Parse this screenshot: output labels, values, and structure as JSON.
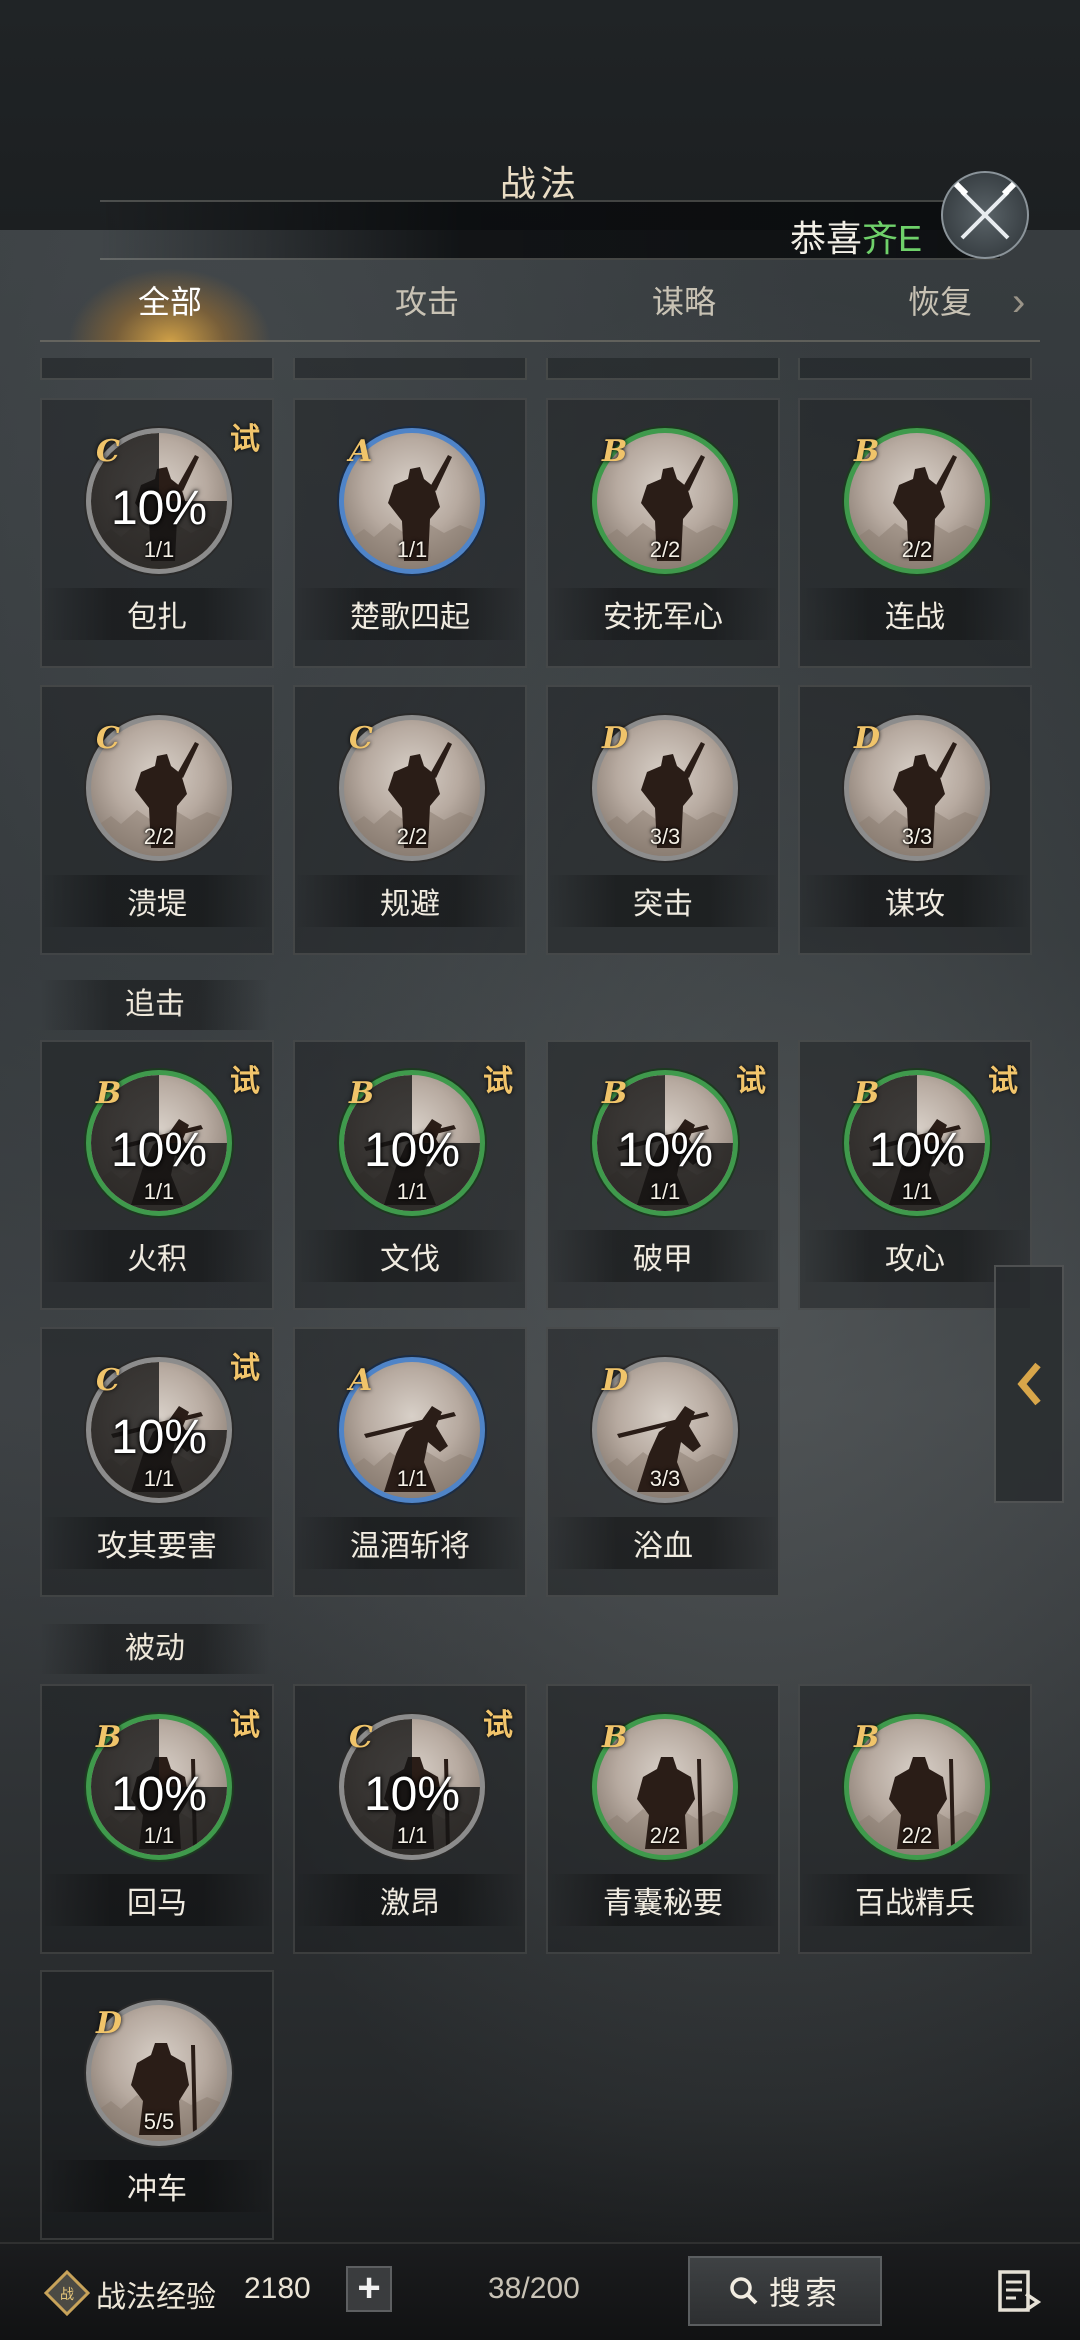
{
  "header": {
    "title": "战法",
    "ticker_prefix": "恭喜",
    "ticker_highlight": "齐E"
  },
  "tabs": [
    {
      "label": "全部",
      "active": true
    },
    {
      "label": "攻击",
      "active": false
    },
    {
      "label": "谋略",
      "active": false
    },
    {
      "label": "恢复",
      "active": false
    }
  ],
  "sections": {
    "pursuit": "追击",
    "passive": "被动"
  },
  "skills": [
    {
      "name": "包扎",
      "grade": "C",
      "count": "1/1",
      "trial": "试",
      "percent": "10%"
    },
    {
      "name": "楚歌四起",
      "grade": "A",
      "count": "1/1"
    },
    {
      "name": "安抚军心",
      "grade": "B",
      "count": "2/2"
    },
    {
      "name": "连战",
      "grade": "B",
      "count": "2/2"
    },
    {
      "name": "溃堤",
      "grade": "C",
      "count": "2/2"
    },
    {
      "name": "规避",
      "grade": "C",
      "count": "2/2"
    },
    {
      "name": "突击",
      "grade": "D",
      "count": "3/3"
    },
    {
      "name": "谋攻",
      "grade": "D",
      "count": "3/3"
    },
    {
      "name": "火积",
      "grade": "B",
      "count": "1/1",
      "trial": "试",
      "percent": "10%"
    },
    {
      "name": "文伐",
      "grade": "B",
      "count": "1/1",
      "trial": "试",
      "percent": "10%"
    },
    {
      "name": "破甲",
      "grade": "B",
      "count": "1/1",
      "trial": "试",
      "percent": "10%"
    },
    {
      "name": "攻心",
      "grade": "B",
      "count": "1/1",
      "trial": "试",
      "percent": "10%"
    },
    {
      "name": "攻其要害",
      "grade": "C",
      "count": "1/1",
      "trial": "试",
      "percent": "10%"
    },
    {
      "name": "温酒斩将",
      "grade": "A",
      "count": "1/1"
    },
    {
      "name": "浴血",
      "grade": "D",
      "count": "3/3"
    },
    {
      "name": "回马",
      "grade": "B",
      "count": "1/1",
      "trial": "试",
      "percent": "10%"
    },
    {
      "name": "激昂",
      "grade": "C",
      "count": "1/1",
      "trial": "试",
      "percent": "10%"
    },
    {
      "name": "青囊秘要",
      "grade": "B",
      "count": "2/2"
    },
    {
      "name": "百战精兵",
      "grade": "B",
      "count": "2/2"
    },
    {
      "name": "冲车",
      "grade": "D",
      "count": "5/5"
    }
  ],
  "footer": {
    "exp_label": "战法经验",
    "exp_value": "2180",
    "plus": "+",
    "count": "38/200",
    "search_label": "搜索"
  },
  "colors": {
    "grade_b": "#3f9a4c",
    "grade_a": "#4f84c8",
    "grade_cd": "#8c8c8c",
    "gold": "#f0c46a",
    "tab_glow": "#ffbe46"
  }
}
